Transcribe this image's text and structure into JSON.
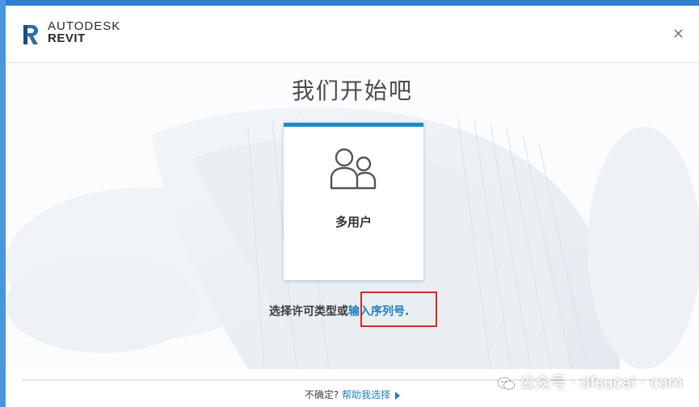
{
  "header": {
    "brand_line1": "AUTODESK",
    "brand_line2": "REVIT",
    "close_glyph": "×"
  },
  "main": {
    "title": "我们开始吧",
    "license_card": {
      "label": "多用户",
      "icon": "multi-user-icon",
      "accent_color": "#1d8ac9"
    },
    "prompt_text": "选择许可类型或",
    "serial_link": "输入序列号",
    "prompt_suffix": ".",
    "highlight_color": "#d7281f"
  },
  "footer": {
    "question": "不确定?",
    "help_link": "帮助我选择"
  },
  "watermark": {
    "text": "公众号 · dfsucai · com"
  }
}
